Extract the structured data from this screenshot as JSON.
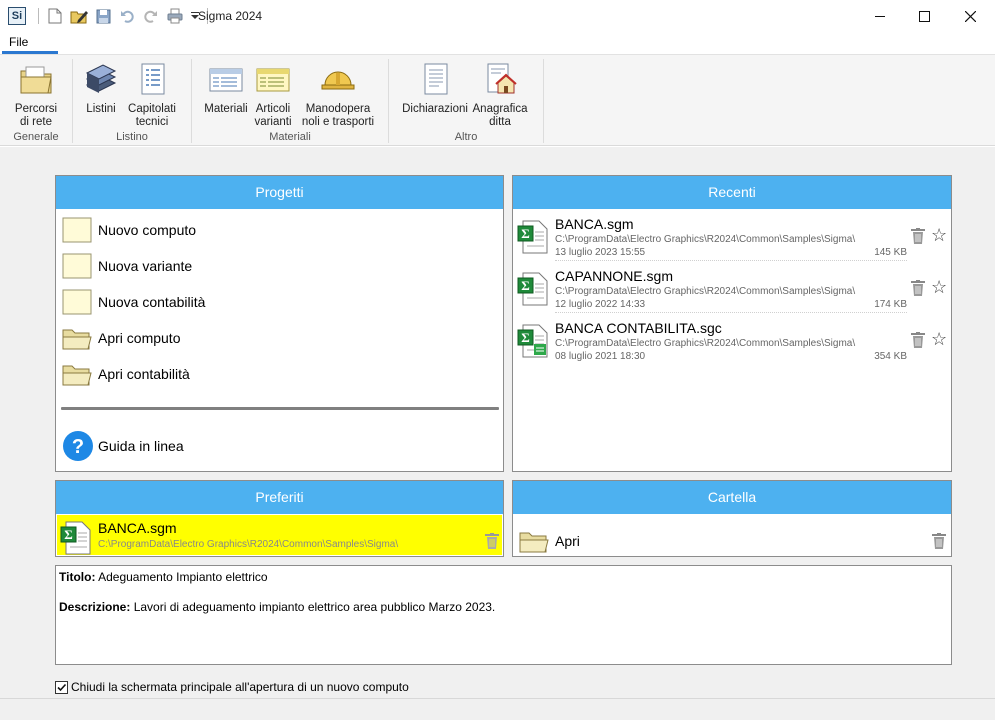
{
  "window": {
    "app_icon_text": "Si",
    "title": "Sigma 2024"
  },
  "menu": {
    "file_label": "File"
  },
  "ribbon": {
    "groups": [
      {
        "label": "Generale",
        "buttons": [
          {
            "label": "Percorsi\ndi rete"
          }
        ]
      },
      {
        "label": "Listino",
        "buttons": [
          {
            "label": "Listini"
          },
          {
            "label": "Capitolati\ntecnici"
          }
        ]
      },
      {
        "label": "Materiali",
        "buttons": [
          {
            "label": "Materiali"
          },
          {
            "label": "Articoli\nvarianti"
          },
          {
            "label": "Manodopera\nnoli e trasporti"
          }
        ]
      },
      {
        "label": "Altro",
        "buttons": [
          {
            "label": "Dichiarazioni"
          },
          {
            "label": "Anagrafica\nditta"
          }
        ]
      }
    ]
  },
  "progetti": {
    "header": "Progetti",
    "items": [
      {
        "label": "Nuovo computo",
        "icon": "new-file-icon"
      },
      {
        "label": "Nuova variante",
        "icon": "new-file-icon"
      },
      {
        "label": "Nuova contabilità",
        "icon": "new-file-icon"
      },
      {
        "label": "Apri computo",
        "icon": "open-folder-icon"
      },
      {
        "label": "Apri contabilità",
        "icon": "open-folder-icon"
      }
    ],
    "help_label": "Guida in linea"
  },
  "recenti": {
    "header": "Recenti",
    "items": [
      {
        "name": "BANCA.sgm",
        "path": "C:\\ProgramData\\Electro Graphics\\R2024\\Common\\Samples\\Sigma\\",
        "date": "13 luglio 2023 15:55",
        "size": "145 KB"
      },
      {
        "name": "CAPANNONE.sgm",
        "path": "C:\\ProgramData\\Electro Graphics\\R2024\\Common\\Samples\\Sigma\\",
        "date": "12 luglio 2022 14:33",
        "size": "174 KB"
      },
      {
        "name": "BANCA CONTABILITA.sgc",
        "path": "C:\\ProgramData\\Electro Graphics\\R2024\\Common\\Samples\\Sigma\\",
        "date": "08 luglio 2021 18:30",
        "size": "354 KB"
      }
    ]
  },
  "preferiti": {
    "header": "Preferiti",
    "items": [
      {
        "name": "BANCA.sgm",
        "path": "C:\\ProgramData\\Electro Graphics\\R2024\\Common\\Samples\\Sigma\\"
      }
    ]
  },
  "cartella": {
    "header": "Cartella",
    "open_label": "Apri"
  },
  "description": {
    "title_label": "Titolo:",
    "title_value": "Adeguamento Impianto elettrico",
    "desc_label": "Descrizione:",
    "desc_value": "Lavori di adeguamento impianto elettrico area pubblico Marzo 2023."
  },
  "options": {
    "close_on_new_label": "Chiudi la schermata principale all'apertura di un nuovo computo",
    "close_on_new_checked": true
  },
  "colors": {
    "panel_header": "#4db1f0",
    "favorite_highlight": "#ffff00",
    "file_tab_underline": "#2b78d0"
  }
}
